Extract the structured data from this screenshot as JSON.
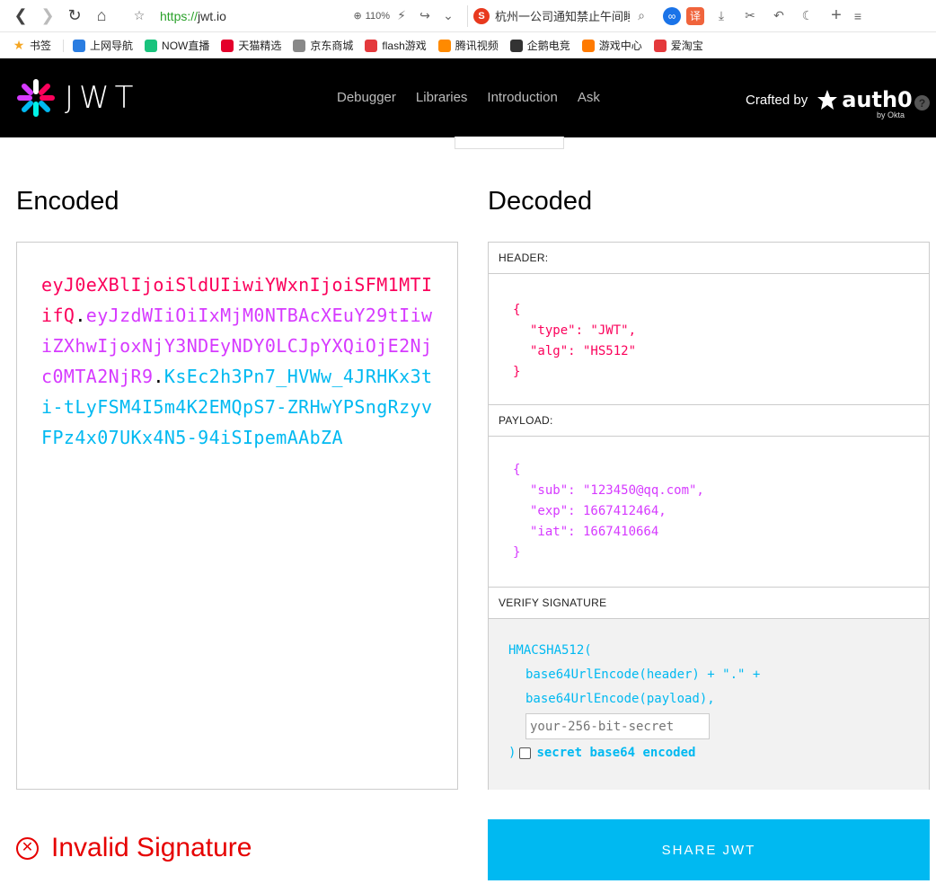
{
  "browser": {
    "url_scheme": "https://",
    "url_host": "jwt.io",
    "zoom": "110%",
    "search_text": "杭州一公司通知禁止午间睡",
    "translate_label": "译"
  },
  "bookmarks": [
    {
      "label": "书签",
      "icon": "star-icon",
      "color": "#f5a623"
    },
    {
      "label": "上网导航",
      "icon": "ie-icon",
      "color": "#2a7de1"
    },
    {
      "label": "NOW直播",
      "icon": "now-icon",
      "color": "#19c37d"
    },
    {
      "label": "天猫精选",
      "icon": "tmall-icon",
      "color": "#e4002b"
    },
    {
      "label": "京东商城",
      "icon": "globe-icon",
      "color": "#888888"
    },
    {
      "label": "flash游戏",
      "icon": "flash-icon",
      "color": "#e4393c"
    },
    {
      "label": "腾讯视频",
      "icon": "play-icon",
      "color": "#ff8a00"
    },
    {
      "label": "企鹅电竞",
      "icon": "penguin-icon",
      "color": "#333333"
    },
    {
      "label": "游戏中心",
      "icon": "gamepad-icon",
      "color": "#ff7a00"
    },
    {
      "label": "爱淘宝",
      "icon": "taobao-icon",
      "color": "#e4393c"
    }
  ],
  "site": {
    "logo_text": "JWT",
    "nav": [
      "Debugger",
      "Libraries",
      "Introduction",
      "Ask"
    ],
    "crafted_by": "Crafted by",
    "auth0": "auth0",
    "by_okta": "by Okta"
  },
  "encoded": {
    "title": "Encoded",
    "header_part": "eyJ0eXBlIjoiSldUIiwiYWxnIjoiSFM1MTIifQ",
    "payload_part": "eyJzdWIiOiIxMjM0NTBAcXEuY29tIiwiZXhwIjoxNjY3NDEyNDY0LCJpYXQiOjE2Njc0MTA2NjR9",
    "signature_part": "KsEc2h3Pn7_HVWw_4JRHKx3ti-tLyFSM4I5m4K2EMQpS7-ZRHwYPSngRzyvFPz4x07UKx4N5-94iSIpemAAbZA",
    "dot": "."
  },
  "decoded": {
    "title": "Decoded",
    "header_label": "HEADER:",
    "header_lines": [
      "{",
      "\"type\": \"JWT\",",
      "\"alg\": \"HS512\"",
      "}"
    ],
    "payload_label": "PAYLOAD:",
    "payload_lines": [
      "{",
      "\"sub\": \"123450@qq.com\",",
      "\"exp\": 1667412464,",
      "\"iat\": 1667410664",
      "}"
    ],
    "verify_label": "VERIFY SIGNATURE",
    "verify_fn": "HMACSHA512(",
    "verify_line1": "base64UrlEncode(header) + \".\" +",
    "verify_line2": "base64UrlEncode(payload),",
    "secret_placeholder": "your-256-bit-secret",
    "close_paren": ")",
    "b64_label": "secret base64 encoded"
  },
  "status": {
    "invalid_text": "Invalid Signature",
    "share_label": "SHARE JWT"
  },
  "colors": {
    "header": "#fb015b",
    "payload": "#d63aff",
    "signature": "#00b9f1",
    "invalid": "#e60000"
  }
}
